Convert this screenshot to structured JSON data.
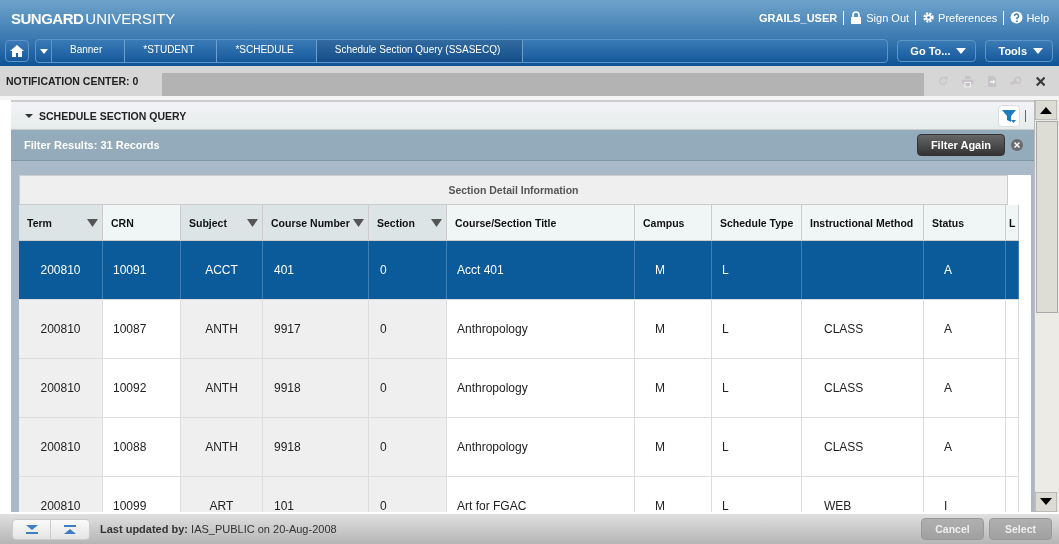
{
  "header": {
    "brand_bold": "SUNGARD",
    "brand": "UNIVERSITY",
    "user": "GRAILS_USER",
    "links": [
      {
        "kind": "lock",
        "label": "Sign Out"
      },
      {
        "kind": "gear",
        "label": "Preferences"
      },
      {
        "kind": "help",
        "label": "Help"
      }
    ]
  },
  "breadcrumbs": [
    "Banner",
    "*STUDENT",
    "*SCHEDULE",
    "Schedule Section Query (SSASECQ)"
  ],
  "menus": [
    "Go To...",
    "Tools"
  ],
  "notification_center": "NOTIFICATION CENTER: 0",
  "section": {
    "title": "SCHEDULE SECTION QUERY",
    "expanded": true
  },
  "filter": {
    "results": "Filter Results: 31 Records",
    "button": "Filter Again"
  },
  "table": {
    "group_header": "Section Detail Information",
    "columns": [
      {
        "label": "Term",
        "filter_arrow": true
      },
      {
        "label": "CRN",
        "filter_arrow": false
      },
      {
        "label": "Subject",
        "filter_arrow": true
      },
      {
        "label": "Course Number",
        "filter_arrow": true
      },
      {
        "label": "Section",
        "filter_arrow": true
      },
      {
        "label": "Course/Section Title",
        "filter_arrow": false
      },
      {
        "label": "Campus",
        "filter_arrow": false
      },
      {
        "label": "Schedule Type",
        "filter_arrow": false
      },
      {
        "label": "Instructional Method",
        "filter_arrow": false
      },
      {
        "label": "Status",
        "filter_arrow": false
      },
      {
        "label": "L",
        "filter_arrow": false
      }
    ],
    "rows": [
      {
        "selected": true,
        "cells": [
          "200810",
          "10091",
          "ACCT",
          "401",
          "0",
          "Acct 401",
          "M",
          "L",
          "",
          "A",
          ""
        ]
      },
      {
        "selected": false,
        "cells": [
          "200810",
          "10087",
          "ANTH",
          "9917",
          "0",
          "Anthropology",
          "M",
          "L",
          "CLASS",
          "A",
          ""
        ]
      },
      {
        "selected": false,
        "cells": [
          "200810",
          "10092",
          "ANTH",
          "9918",
          "0",
          "Anthropology",
          "M",
          "L",
          "CLASS",
          "A",
          ""
        ]
      },
      {
        "selected": false,
        "cells": [
          "200810",
          "10088",
          "ANTH",
          "9918",
          "0",
          "Anthropology",
          "M",
          "L",
          "CLASS",
          "A",
          ""
        ]
      },
      {
        "selected": false,
        "cells": [
          "200810",
          "10099",
          "ART",
          "101",
          "0",
          "Art for FGAC",
          "M",
          "L",
          "WEB",
          "I",
          ""
        ]
      }
    ]
  },
  "footer": {
    "updated_label": "Last updated by:",
    "updated_value": "IAS_PUBLIC on 20-Aug-2008",
    "buttons": [
      {
        "label": "Cancel",
        "disabled": true
      },
      {
        "label": "Select",
        "disabled": true
      }
    ]
  }
}
